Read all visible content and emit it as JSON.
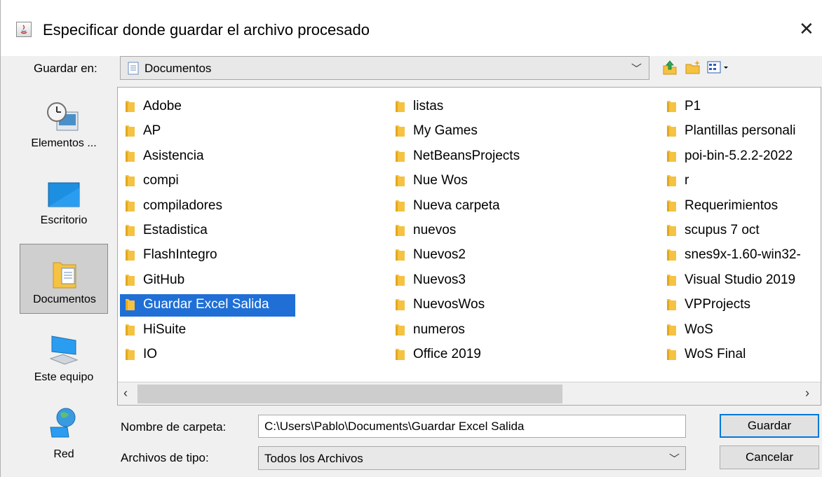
{
  "dialog": {
    "title": "Especificar donde guardar el archivo procesado",
    "close_label": "✕"
  },
  "save_in": {
    "label": "Guardar en:",
    "value": "Documentos"
  },
  "toolbar": {
    "up_icon": "up-folder-icon",
    "new_folder_icon": "new-folder-icon",
    "view_menu_icon": "view-menu-icon"
  },
  "places": [
    {
      "label": "Elementos ...",
      "icon": "recent-items-icon"
    },
    {
      "label": "Escritorio",
      "icon": "desktop-icon"
    },
    {
      "label": "Documentos",
      "icon": "documents-icon",
      "selected": true
    },
    {
      "label": "Este equipo",
      "icon": "computer-icon"
    },
    {
      "label": "Red",
      "icon": "network-icon"
    }
  ],
  "files": {
    "col1": [
      "Adobe",
      "AP",
      "Asistencia",
      "compi",
      "compiladores",
      "Estadistica",
      "FlashIntegro",
      "GitHub",
      "Guardar Excel Salida",
      "HiSuite",
      "IO"
    ],
    "col2": [
      "listas",
      "My Games",
      "NetBeansProjects",
      "Nue Wos",
      "Nueva carpeta",
      "nuevos",
      "Nuevos2",
      "Nuevos3",
      "NuevosWos",
      "numeros",
      "Office 2019"
    ],
    "col3": [
      "P1",
      "Plantillas personali",
      "poi-bin-5.2.2-2022",
      "r",
      "Requerimientos",
      "scupus 7 oct",
      "snes9x-1.60-win32-",
      "Visual Studio 2019",
      "VPProjects",
      "WoS",
      "WoS Final"
    ],
    "selected": "Guardar Excel Salida"
  },
  "folder_name": {
    "label": "Nombre de carpeta:",
    "value": "C:\\Users\\Pablo\\Documents\\Guardar Excel Salida"
  },
  "file_type": {
    "label": "Archivos de tipo:",
    "value": "Todos los Archivos"
  },
  "buttons": {
    "save": "Guardar",
    "cancel": "Cancelar"
  },
  "colors": {
    "selection": "#1f6fd6",
    "folder": "#f5c242"
  }
}
